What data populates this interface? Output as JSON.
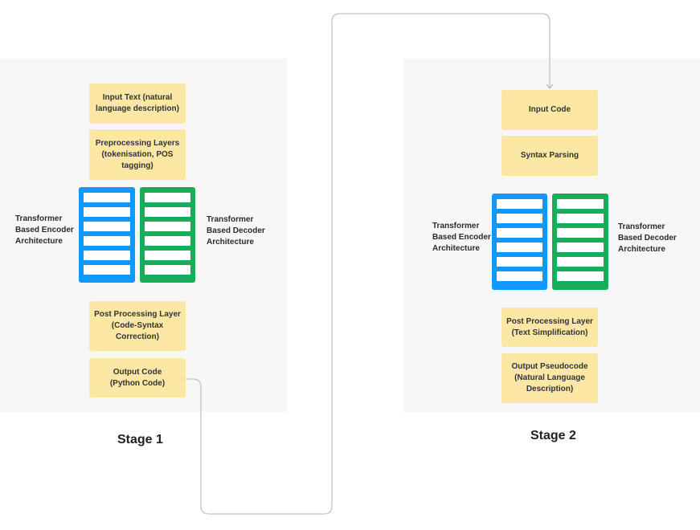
{
  "colors": {
    "panel": "#f7f7f7",
    "box": "#fde7a4",
    "encoder": "#1098fc",
    "decoder": "#17ad5b",
    "connector": "#c4c4c4"
  },
  "stage1": {
    "title": "Stage 1",
    "boxes": [
      "Input Text (natural\nlanguage description)",
      "Preprocessing Layers\n(tokenisation, POS\ntagging)",
      "Post Processing Layer\n(Code-Syntax\nCorrection)",
      "Output Code\n(Python Code)"
    ],
    "encoder_label": "Transformer\nBased Encoder\nArchitecture",
    "decoder_label": "Transformer\nBased Decoder\nArchitecture",
    "encoder_layers": 6,
    "decoder_layers": 6
  },
  "stage2": {
    "title": "Stage 2",
    "boxes": [
      "Input Code",
      "Syntax Parsing",
      "Post Processing Layer\n(Text Simplification)",
      "Output Pseudocode\n(Natural Language\nDescription)"
    ],
    "encoder_label": "Transformer\nBased Encoder\nArchitecture",
    "decoder_label": "Transformer\nBased Decoder\nArchitecture",
    "encoder_layers": 6,
    "decoder_layers": 6
  },
  "connector": {
    "from": "Output Code (Python Code)",
    "to": "Input Code"
  }
}
